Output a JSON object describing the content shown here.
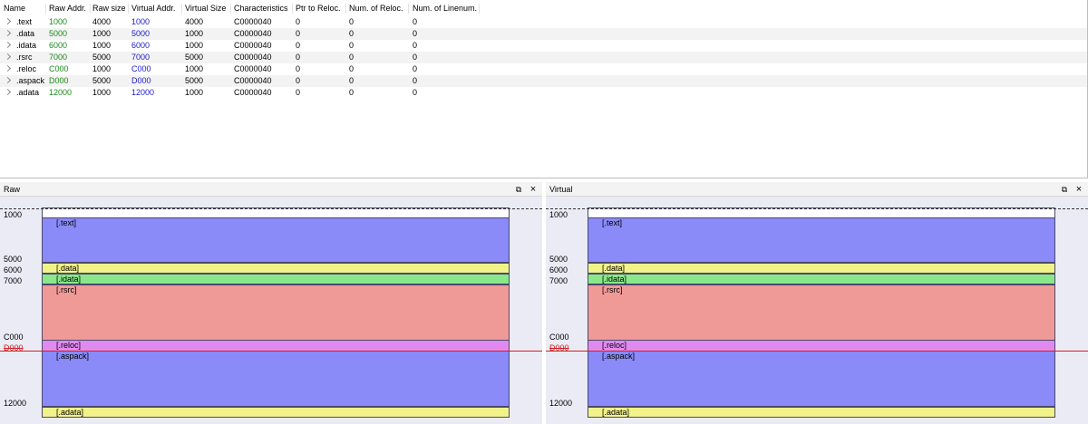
{
  "table": {
    "columns": [
      "Name",
      "Raw Addr.",
      "Raw size",
      "Virtual Addr.",
      "Virtual Size",
      "Characteristics",
      "Ptr to Reloc.",
      "Num. of Reloc.",
      "Num. of Linenum."
    ],
    "rows": [
      {
        "name": ".text",
        "raw_addr": "1000",
        "raw_size": "4000",
        "virt_addr": "1000",
        "virt_size": "4000",
        "characteristics": "C0000040",
        "ptr_reloc": "0",
        "num_reloc": "0",
        "num_linenum": "0"
      },
      {
        "name": ".data",
        "raw_addr": "5000",
        "raw_size": "1000",
        "virt_addr": "5000",
        "virt_size": "1000",
        "characteristics": "C0000040",
        "ptr_reloc": "0",
        "num_reloc": "0",
        "num_linenum": "0"
      },
      {
        "name": ".idata",
        "raw_addr": "6000",
        "raw_size": "1000",
        "virt_addr": "6000",
        "virt_size": "1000",
        "characteristics": "C0000040",
        "ptr_reloc": "0",
        "num_reloc": "0",
        "num_linenum": "0"
      },
      {
        "name": ".rsrc",
        "raw_addr": "7000",
        "raw_size": "5000",
        "virt_addr": "7000",
        "virt_size": "5000",
        "characteristics": "C0000040",
        "ptr_reloc": "0",
        "num_reloc": "0",
        "num_linenum": "0"
      },
      {
        "name": ".reloc",
        "raw_addr": "C000",
        "raw_size": "1000",
        "virt_addr": "C000",
        "virt_size": "1000",
        "characteristics": "C0000040",
        "ptr_reloc": "0",
        "num_reloc": "0",
        "num_linenum": "0"
      },
      {
        "name": ".aspack",
        "raw_addr": "D000",
        "raw_size": "5000",
        "virt_addr": "D000",
        "virt_size": "5000",
        "characteristics": "C0000040",
        "ptr_reloc": "0",
        "num_reloc": "0",
        "num_linenum": "0"
      },
      {
        "name": ".adata",
        "raw_addr": "12000",
        "raw_size": "1000",
        "virt_addr": "12000",
        "virt_size": "1000",
        "characteristics": "C0000040",
        "ptr_reloc": "0",
        "num_reloc": "0",
        "num_linenum": "0"
      }
    ],
    "raw_addr_color": "#1a8a1a",
    "virt_addr_color": "#1a1ad0"
  },
  "panels": {
    "raw": {
      "title": "Raw"
    },
    "virtual": {
      "title": "Virtual"
    },
    "float_icon": "⧉",
    "close_icon": "×",
    "address_labels": [
      "1000",
      "5000",
      "6000",
      "7000",
      "C000",
      "D000",
      "12000"
    ],
    "highlighted_address": "D000",
    "section_labels": [
      "[.text]",
      "[.data]",
      "[.idata]",
      "[.rsrc]",
      "[.reloc]",
      "[.aspack]",
      "[.adata]"
    ],
    "section_colors": [
      "#8a8af8",
      "#f2f28a",
      "#8ae88a",
      "#f09a98",
      "#e08af0",
      "#8a8af8",
      "#f2f28a"
    ],
    "highlight_color": "#d02020"
  }
}
